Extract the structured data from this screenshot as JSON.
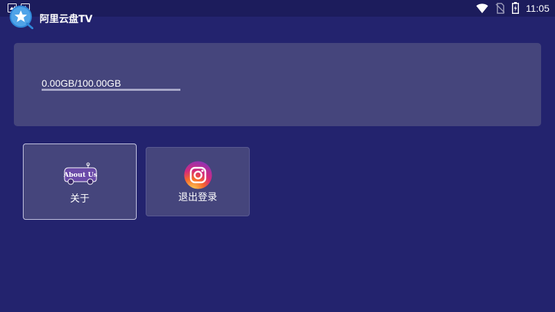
{
  "status_bar": {
    "left_icons": [
      "image-icon",
      "a-icon"
    ],
    "a_icon_text": "A",
    "right_icons": [
      "wifi-icon",
      "no-sim-icon",
      "battery-charging-icon"
    ],
    "time": "11:05"
  },
  "app": {
    "title": "阿里云盘TV",
    "logo_icon": "cloud-star-logo-icon"
  },
  "storage": {
    "text": "0.00GB/100.00GB",
    "used_fraction": 0.0
  },
  "tiles": [
    {
      "label": "关于",
      "icon": "about-us-icon",
      "icon_text": "About Us",
      "focused": true
    },
    {
      "label": "退出登录",
      "icon": "instagram-icon",
      "focused": false
    }
  ],
  "colors": {
    "background": "#23236e",
    "card": "#45457c",
    "focus_border": "#c9c9e4"
  }
}
